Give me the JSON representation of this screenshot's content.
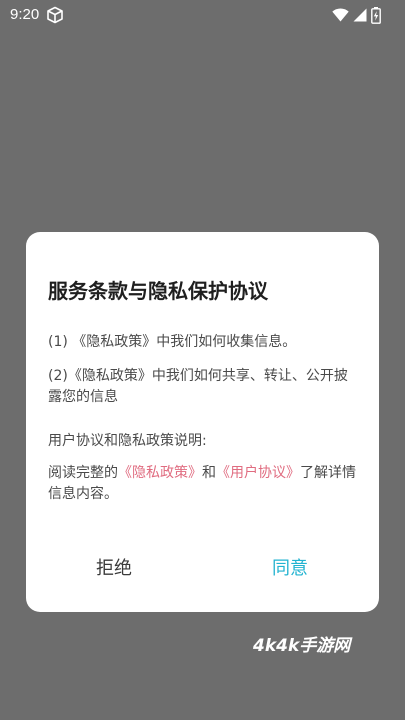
{
  "status_bar": {
    "time": "9:20",
    "icons": [
      "package-cube-icon",
      "wifi-icon",
      "cell-signal-icon",
      "battery-charging-icon"
    ]
  },
  "dialog": {
    "title": "服务条款与隐私保护协议",
    "para1": "(1) 《隐私政策》中我们如何收集信息。",
    "para2": "(2)《隐私政策》中我们如何共享、转让、公开披露您的信息",
    "para3": "用户协议和隐私政策说明:",
    "para4": {
      "prefix": "阅读完整的",
      "privacy_link": "《隐私政策》",
      "middle": "和",
      "user_link": "《用户协议》",
      "suffix": "了解详情信息内容。"
    },
    "reject_label": "拒绝",
    "agree_label": "同意"
  },
  "watermark": {
    "text": "4k4k手游网"
  },
  "colors": {
    "overlay": "#6d6d6d",
    "link": "#e06c80",
    "agree": "#22b3d0",
    "dialog_bg": "#ffffff"
  }
}
